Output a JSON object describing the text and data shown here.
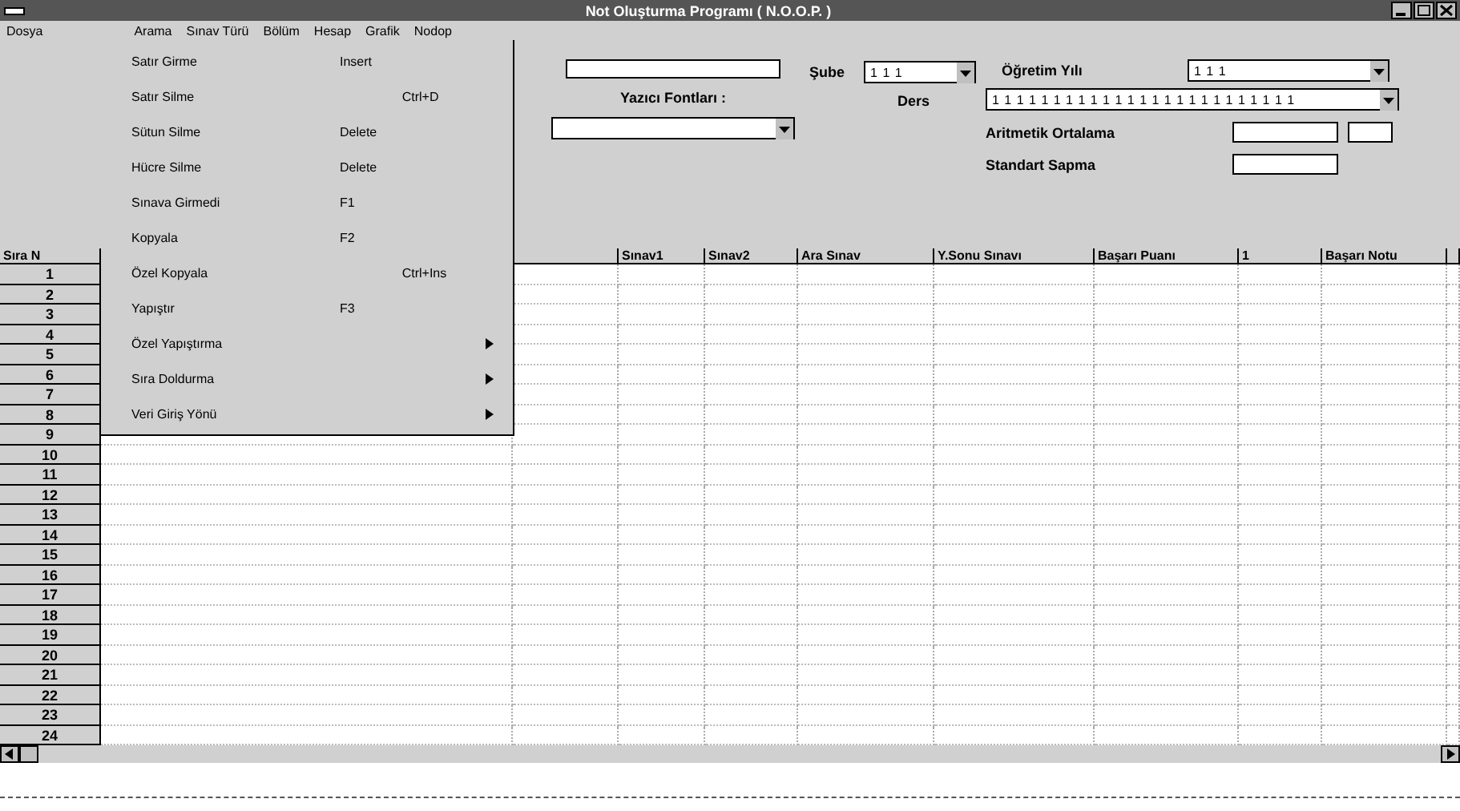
{
  "window": {
    "title": "Not Oluşturma Programı ( N.O.O.P. )"
  },
  "menu_bar": [
    {
      "label": "Dosya"
    },
    {
      "label": "Arama"
    },
    {
      "label": "Sınav Türü"
    },
    {
      "label": "Bölüm"
    },
    {
      "label": "Hesap"
    },
    {
      "label": "Grafik"
    },
    {
      "label": "Nodop"
    }
  ],
  "dropdown": {
    "items": [
      {
        "label": "Satır Girme",
        "shortcut": "Insert",
        "kind": "shortcut"
      },
      {
        "label": "Satır Silme",
        "shortcut": "Ctrl+D",
        "kind": "shortcut_far"
      },
      {
        "label": "Sütun Silme",
        "shortcut": "Delete",
        "kind": "shortcut"
      },
      {
        "label": "Hücre Silme",
        "shortcut": "Delete",
        "kind": "shortcut"
      },
      {
        "label": "Sınava Girmedi",
        "shortcut": "F1",
        "kind": "shortcut"
      },
      {
        "label": "Kopyala",
        "shortcut": "F2",
        "kind": "shortcut"
      },
      {
        "label": "Özel Kopyala",
        "shortcut": "Ctrl+Ins",
        "kind": "shortcut_far"
      },
      {
        "label": "Yapıştır",
        "shortcut": "F3",
        "kind": "shortcut"
      },
      {
        "label": "Özel Yapıştırma",
        "kind": "submenu"
      },
      {
        "label": "Sıra Doldurma",
        "kind": "submenu"
      },
      {
        "label": "Veri Giriş Yönü",
        "kind": "submenu"
      }
    ]
  },
  "form": {
    "sube": {
      "label": "Şube",
      "value": "1 1 1"
    },
    "ogretim_yili": {
      "label": "Öğretim Yılı",
      "value": "1 1 1"
    },
    "yazici_fontlari": {
      "label": "Yazıcı Fontları :"
    },
    "ders": {
      "label": "Ders",
      "value": "1 1 1 1 1 1 1 1 1 1 1 1 1 1 1 1 1 1 1 1 1 1 1 1 1"
    },
    "aritmetik_ortalama": {
      "label": "Aritmetik Ortalama"
    },
    "standart_sapma": {
      "label": "Standart Sapma"
    }
  },
  "table": {
    "columns": [
      "Sıra N",
      "Sınav1",
      "Sınav2",
      "Ara Sınav",
      "Y.Sonu Sınavı",
      "Başarı Puanı",
      "1",
      "Başarı Notu"
    ],
    "rows": [
      "1",
      "2",
      "3",
      "4",
      "5",
      "6",
      "7",
      "8",
      "9",
      "10",
      "11",
      "12",
      "13",
      "14",
      "15",
      "16",
      "17",
      "18",
      "19",
      "20",
      "21",
      "22",
      "23",
      "24"
    ]
  }
}
